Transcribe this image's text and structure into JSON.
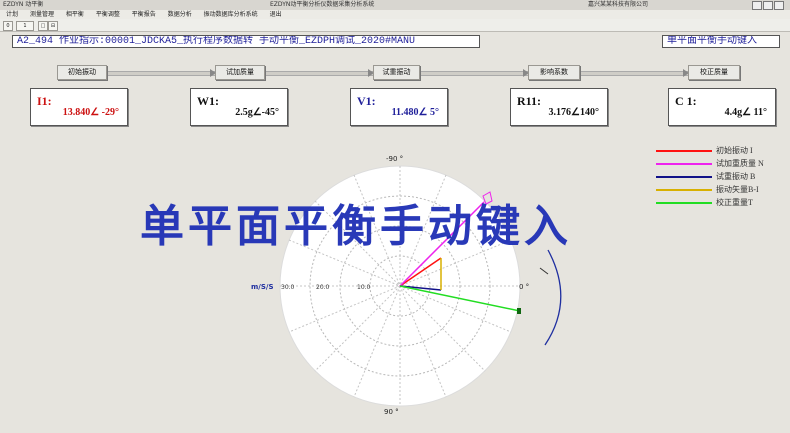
{
  "window": {
    "title": "EZDYN 动平衡",
    "caption": "EZDYN动平衡分析仪数据采集分析系统",
    "company": "嘉兴某某科技有限公司"
  },
  "menu": [
    "计划",
    "测量管理",
    "相平衡",
    "平衡调整",
    "平衡报告",
    "数据分析",
    "振动数据库分析系统",
    "退出"
  ],
  "toolbar": [
    "0",
    "1",
    "□",
    "⊟"
  ],
  "info_left": "A2_494 作业指示:00001_JDCKA5_执行程序数据转 手动平衡_EZDPH调试_2020#MANU",
  "info_right": "单平面平衡手动键入",
  "steps": [
    "初始振动",
    "试加质量",
    "试重振动",
    "影响系数",
    "校正质量"
  ],
  "vectors": [
    {
      "label": "I1:",
      "value": "13.840∠ -29°",
      "color": "#cc1111"
    },
    {
      "label": "W1:",
      "value": "2.5g∠-45°",
      "color": "#111111"
    },
    {
      "label": "V1:",
      "value": "11.480∠ 5°",
      "color": "#1f1f9a"
    },
    {
      "label": "R11:",
      "value": "3.176∠140°",
      "color": "#111111"
    },
    {
      "label": "C 1:",
      "value": "4.4g∠ 11°",
      "color": "#111111"
    }
  ],
  "legend": [
    {
      "label": "初始振动 I",
      "color": "#ff1111"
    },
    {
      "label": "试加重质量 N",
      "color": "#ee22ee"
    },
    {
      "label": "试重振动 B",
      "color": "#111188"
    },
    {
      "label": "振动矢量B-I",
      "color": "#d8b000"
    },
    {
      "label": "校正重量T",
      "color": "#22dd22"
    }
  ],
  "polar": {
    "top_label": "-90 °",
    "bottom_label": "90 °",
    "right_label": "0 °",
    "unit_label": "m/S/S",
    "scale": [
      "30.0",
      "20.0",
      "10.0"
    ]
  },
  "overlay_title": "单平面平衡手动键入"
}
